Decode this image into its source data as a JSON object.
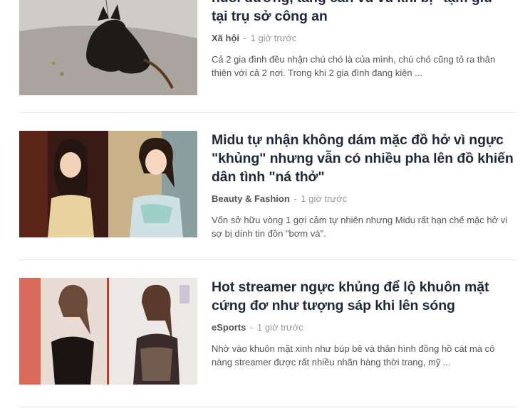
{
  "articles": [
    {
      "title": "nuôi dưỡng, tăng cân vù vù khi bị \"tạm giữ\" tại trụ sở công an",
      "category": "Xã hội",
      "time": "1 giờ trước",
      "excerpt": "Cả 2 gia đình đều nhận chú chó là của mình, chú chó cũng tỏ ra thân thiện với cả 2 nơi. Trong khi 2 gia đình đang kiện ..."
    },
    {
      "title": "Midu tự nhận không dám mặc đồ hở vì ngực \"khủng\" nhưng vẫn có nhiều pha lên đồ khiến dân tình \"ná thở\"",
      "category": "Beauty & Fashion",
      "time": "1 giờ trước",
      "excerpt": "Vốn sở hữu vòng 1 gợi cảm tự nhiên nhưng Midu rất hạn chế mặc hở vì sợ bị dính tin đồn \"bơm vá\"."
    },
    {
      "title": "Hot streamer ngực khủng để lộ khuôn mặt cứng đơ như tượng sáp khi lên sóng",
      "category": "eSports",
      "time": "1 giờ trước",
      "excerpt": "Nhờ vào khuôn mặt xinh như búp bê và thân hình đồng hồ cát mà cô nàng streamer được rất nhiều nhãn hàng thời trang, mỹ ..."
    }
  ],
  "separator": "-",
  "colors": {
    "title": "#1f2937",
    "category": "#555555",
    "time": "#999999",
    "divider": "#e8e8e8"
  }
}
